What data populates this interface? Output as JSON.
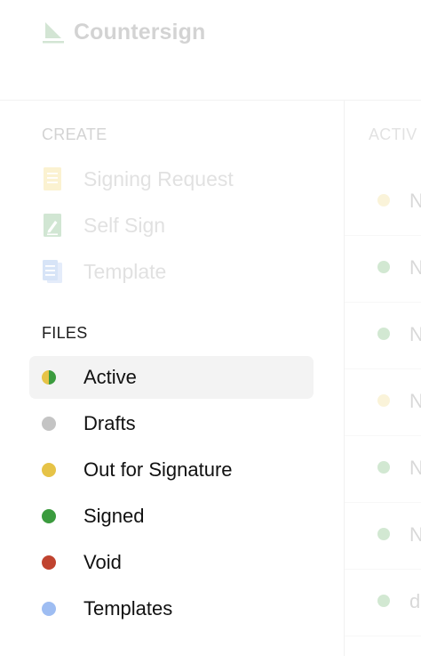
{
  "brand": {
    "name": "Countersign",
    "logo_icon": "countersign-logo-icon"
  },
  "sidebar": {
    "create": {
      "label": "CREATE",
      "items": [
        {
          "label": "Signing Request",
          "icon": "signing-request-icon",
          "color": "#f3d769"
        },
        {
          "label": "Self Sign",
          "icon": "self-sign-icon",
          "color": "#6bb070"
        },
        {
          "label": "Template",
          "icon": "template-icon",
          "color": "#7ea7e8"
        }
      ]
    },
    "files": {
      "label": "FILES",
      "items": [
        {
          "label": "Active",
          "status_color": "split-yellow-green",
          "selected": true
        },
        {
          "label": "Drafts",
          "status_color": "#c4c4c4"
        },
        {
          "label": "Out for Signature",
          "status_color": "#e6c347"
        },
        {
          "label": "Signed",
          "status_color": "#3b9b3e"
        },
        {
          "label": "Void",
          "status_color": "#c0432f"
        },
        {
          "label": "Templates",
          "status_color": "#9ebdf2"
        }
      ]
    }
  },
  "list": {
    "header": "ACTIV",
    "rows": [
      {
        "text": "N",
        "status_color": "#f0d77a"
      },
      {
        "text": "N",
        "status_color": "#5fae62"
      },
      {
        "text": "N",
        "status_color": "#5fae62"
      },
      {
        "text": "N",
        "status_color": "#f0d77a"
      },
      {
        "text": "N",
        "status_color": "#5fae62"
      },
      {
        "text": "N",
        "status_color": "#5fae62"
      },
      {
        "text": "d",
        "status_color": "#5fae62"
      }
    ]
  },
  "colors": {
    "selected_background": "#f3f3f3",
    "divider": "#f1f1f1"
  }
}
